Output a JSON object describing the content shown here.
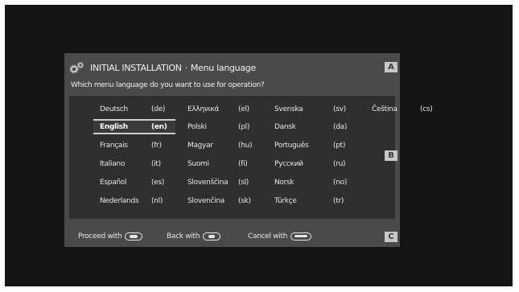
{
  "header": {
    "section": "INITIAL INSTALLATION",
    "separator": "·",
    "subtitle": "Menu language"
  },
  "question": "Which menu language do you want to use for operation?",
  "languages": [
    {
      "name": "Deutsch",
      "code": "(de)"
    },
    {
      "name": "English",
      "code": "(en)"
    },
    {
      "name": "Français",
      "code": "(fr)"
    },
    {
      "name": "Italiano",
      "code": "(it)"
    },
    {
      "name": "Español",
      "code": "(es)"
    },
    {
      "name": "Nederlands",
      "code": "(nl)"
    },
    {
      "name": "Ελληνικά",
      "code": "(el)"
    },
    {
      "name": "Polski",
      "code": "(pl)"
    },
    {
      "name": "Magyar",
      "code": "(hu)"
    },
    {
      "name": "Suomi",
      "code": "(fi)"
    },
    {
      "name": "Slovenščina",
      "code": "(sl)"
    },
    {
      "name": "Slovenčina",
      "code": "(sk)"
    },
    {
      "name": "Svenska",
      "code": "(sv)"
    },
    {
      "name": "Dansk",
      "code": "(da)"
    },
    {
      "name": "Português",
      "code": "(pt)"
    },
    {
      "name": "Русский",
      "code": "(ru)"
    },
    {
      "name": "Norsk",
      "code": "(no)"
    },
    {
      "name": "Türkçe",
      "code": "(tr)"
    },
    {
      "name": "Čeština",
      "code": "(cs)"
    }
  ],
  "selected_language": "English",
  "badges": {
    "a": "A",
    "b": "B",
    "c": "C"
  },
  "footer": {
    "proceed": "Proceed with",
    "back": "Back with",
    "cancel": "Cancel with"
  },
  "colors": {
    "screen_bg": "#141414",
    "panel_bg": "#4a4a4a",
    "list_bg": "#2f2f2f",
    "badge_bg": "#c8c8c8"
  },
  "icons": {
    "title": "gears-icon",
    "ok_key": "remote-ok-key-icon",
    "back_key": "remote-back-key-icon",
    "cancel_key": "remote-back-key-icon"
  }
}
